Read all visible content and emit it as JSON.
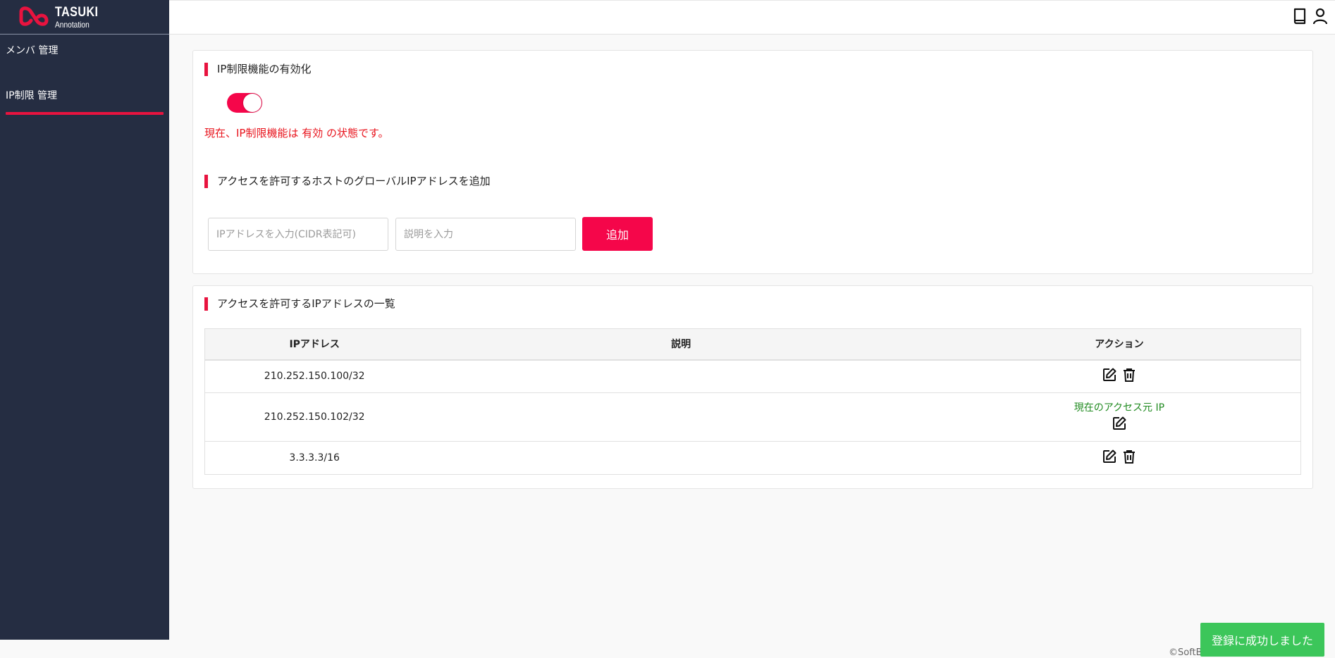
{
  "app": {
    "logo_title": "TASUKI",
    "logo_subtitle": "Annotation",
    "brand_color": "#f5064a"
  },
  "sidebar": {
    "items": [
      {
        "label": "メンバ 管理",
        "active": false
      },
      {
        "label": "IP制限 管理",
        "active": true
      }
    ]
  },
  "header": {
    "icons": [
      "book-icon",
      "user-icon"
    ]
  },
  "restriction": {
    "title": "IP制限機能の有効化",
    "enabled": true,
    "status_text": "現在、IP制限機能は 有効 の状態です。"
  },
  "add_form": {
    "title": "アクセスを許可するホストのグローバルIPアドレスを追加",
    "ip_placeholder": "IPアドレスを入力(CIDR表記可)",
    "ip_value": "",
    "desc_placeholder": "説明を入力",
    "desc_value": "",
    "add_label": "追加"
  },
  "list": {
    "title": "アクセスを許可するIPアドレスの一覧",
    "columns": [
      "IPアドレス",
      "説明",
      "アクション"
    ],
    "rows": [
      {
        "ip": "210.252.150.100/32",
        "description": "",
        "note": "",
        "actions": [
          "edit-icon",
          "delete-icon"
        ]
      },
      {
        "ip": "210.252.150.102/32",
        "description": "",
        "note": "現在のアクセス元 IP",
        "actions": [
          "edit-icon"
        ]
      },
      {
        "ip": "3.3.3.3/16",
        "description": "",
        "note": "",
        "actions": [
          "edit-icon",
          "delete-icon"
        ]
      }
    ]
  },
  "toast": {
    "message": "登録に成功しました",
    "color": "#3cc65a"
  },
  "footer": {
    "text": "©SoftB"
  }
}
